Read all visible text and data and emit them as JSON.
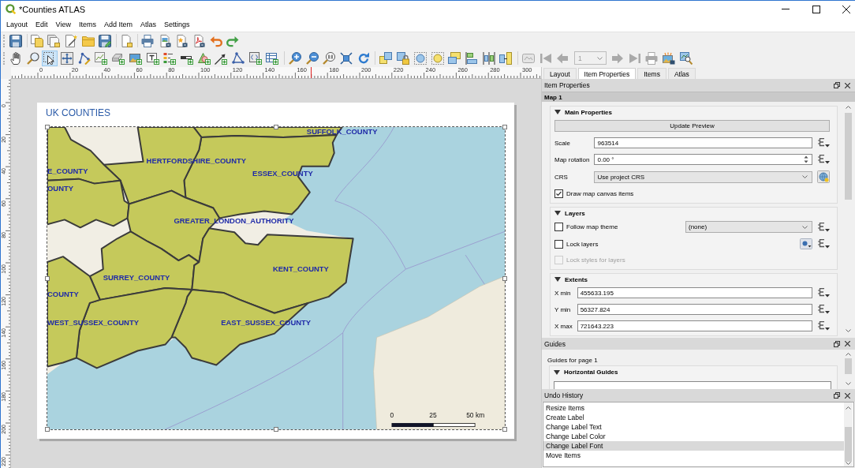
{
  "window": {
    "title": "*Counties ATLAS"
  },
  "menu": [
    "Layout",
    "Edit",
    "View",
    "Items",
    "Add Item",
    "Atlas",
    "Settings"
  ],
  "item_tools": [
    {
      "selected": false
    },
    {
      "selected": false
    },
    {
      "selected": true
    },
    {
      "selected": false
    },
    {
      "selected": false
    },
    {
      "selected": false
    },
    {
      "selected": false
    },
    {
      "selected": false
    },
    {
      "selected": false
    },
    {
      "selected": false
    },
    {
      "selected": false
    },
    {
      "selected": false
    },
    {
      "selected": false
    },
    {
      "selected": false
    },
    {
      "selected": false
    },
    {
      "selected": false
    }
  ],
  "atlas_toolbar": {
    "page": "1",
    "disabled": true
  },
  "rulers": {
    "horizontal": [
      "0",
      "20",
      "40",
      "60",
      "80",
      "100",
      "120",
      "140",
      "160",
      "180",
      "200",
      "220",
      "240",
      "260",
      "280",
      "300"
    ],
    "vertical": [
      "0",
      "20",
      "40",
      "60",
      "80",
      "100",
      "120",
      "140",
      "160",
      "180",
      "200",
      "220"
    ]
  },
  "layout_page": {
    "title": "UK COUNTIES",
    "map": {
      "selected": true,
      "labels": [
        "SUFFOLK_COUNTY",
        "HERTFORDSHIRE_COUNTY",
        "E_COUNTY",
        "ESSEX_COUNTY",
        "OUNTY",
        "GREATER_LONDON_AUTHORITY",
        "KENT_COUNTY",
        "SURREY_COUNTY",
        "COUNTY",
        "WEST_SUSSEX_COUNTY",
        "EAST_SUSSEX_COUNTY"
      ],
      "scalebar": [
        "0",
        "25",
        "50 km"
      ]
    }
  },
  "panel_tabs": [
    {
      "label": "Layout",
      "selected": false
    },
    {
      "label": "Item Properties",
      "selected": true
    },
    {
      "label": "Items",
      "selected": false
    },
    {
      "label": "Atlas",
      "selected": false
    }
  ],
  "item_properties": {
    "title": "Item Properties",
    "item_name": "Map 1",
    "groups": [
      {
        "title": "Main Properties",
        "expanded": true,
        "rows": [
          {
            "kind": "button",
            "label": "Update Preview",
            "disabled": false
          },
          {
            "kind": "field",
            "label": "Scale",
            "value": "963514",
            "disabled": false
          },
          {
            "kind": "spinbox",
            "label": "Map rotation",
            "value": "0.00 °",
            "disabled": false
          },
          {
            "kind": "combo",
            "label": "CRS",
            "value": "Use project CRS",
            "disabled": false
          },
          {
            "kind": "checkbox",
            "label": "Draw map canvas items",
            "checked": true,
            "disabled": false
          }
        ]
      },
      {
        "title": "Layers",
        "expanded": true,
        "rows": [
          {
            "kind": "checkbox_combo",
            "label": "Follow map theme",
            "checked": false,
            "value": "(none)",
            "disabled": false
          },
          {
            "kind": "checkbox_button",
            "label": "Lock layers",
            "checked": false,
            "disabled": false
          },
          {
            "kind": "checkbox",
            "label": "Lock styles for layers",
            "checked": false,
            "disabled": true
          }
        ]
      },
      {
        "title": "Extents",
        "expanded": true,
        "rows": [
          {
            "kind": "field",
            "label": "X min",
            "value": "455633.195",
            "disabled": false
          },
          {
            "kind": "field",
            "label": "Y min",
            "value": "56327.824",
            "disabled": false
          },
          {
            "kind": "field",
            "label": "X max",
            "value": "721643.223",
            "disabled": false
          }
        ]
      }
    ]
  },
  "guides": {
    "title": "Guides",
    "page_label": "Guides for page 1",
    "section": "Horizontal Guides",
    "expanded": true
  },
  "undo_history": {
    "title": "Undo History",
    "items": [
      {
        "label": "Resize Items",
        "selected": false
      },
      {
        "label": "Create Label",
        "selected": false
      },
      {
        "label": "Change Label Text",
        "selected": false
      },
      {
        "label": "Change Label Color",
        "selected": false
      },
      {
        "label": "Change Label Font",
        "selected": true
      },
      {
        "label": "Move Items",
        "selected": false
      }
    ]
  }
}
